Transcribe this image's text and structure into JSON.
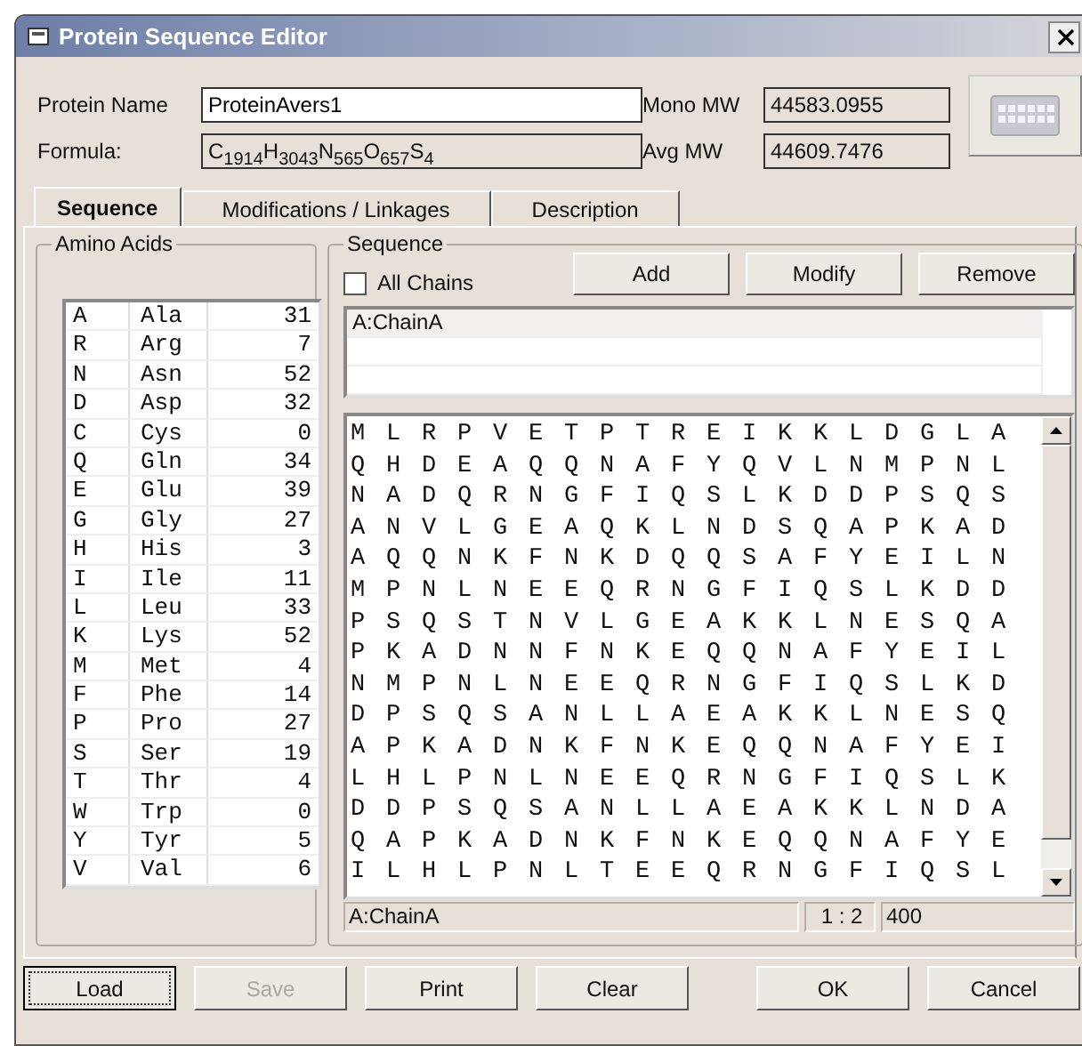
{
  "window": {
    "title": "Protein Sequence Editor"
  },
  "fields": {
    "protein_name_label": "Protein Name",
    "protein_name": "ProteinAvers1",
    "formula_label": "Formula:",
    "formula": "C$_{1914}$H$_{3043}$N$_{565}$O$_{657}$S$_{4}$",
    "mono_mw_label": "Mono MW",
    "mono_mw": "44583.0955",
    "avg_mw_label": "Avg MW",
    "avg_mw": "44609.7476"
  },
  "tabs": [
    {
      "label": "Sequence",
      "selected": true
    },
    {
      "label": "Modifications / Linkages",
      "selected": false
    },
    {
      "label": "Description",
      "selected": false
    }
  ],
  "amino_acids": {
    "title": "Amino Acids",
    "rows": [
      [
        "A",
        "Ala",
        "31"
      ],
      [
        "R",
        "Arg",
        "7"
      ],
      [
        "N",
        "Asn",
        "52"
      ],
      [
        "D",
        "Asp",
        "32"
      ],
      [
        "C",
        "Cys",
        "0"
      ],
      [
        "Q",
        "Gln",
        "34"
      ],
      [
        "E",
        "Glu",
        "39"
      ],
      [
        "G",
        "Gly",
        "27"
      ],
      [
        "H",
        "His",
        "3"
      ],
      [
        "I",
        "Ile",
        "11"
      ],
      [
        "L",
        "Leu",
        "33"
      ],
      [
        "K",
        "Lys",
        "52"
      ],
      [
        "M",
        "Met",
        "4"
      ],
      [
        "F",
        "Phe",
        "14"
      ],
      [
        "P",
        "Pro",
        "27"
      ],
      [
        "S",
        "Ser",
        "19"
      ],
      [
        "T",
        "Thr",
        "4"
      ],
      [
        "W",
        "Trp",
        "0"
      ],
      [
        "Y",
        "Tyr",
        "5"
      ],
      [
        "V",
        "Val",
        "6"
      ]
    ]
  },
  "sequence": {
    "title": "Sequence",
    "all_chains": {
      "label": "All Chains",
      "checked": false
    },
    "buttons": [
      "Add",
      "Modify",
      "Remove"
    ],
    "chains": [
      {
        "label": "A:ChainA",
        "selected": true
      }
    ],
    "rows": [
      "M L R P V E T P T R E I K K L D G L A",
      "Q H D E A Q Q N A F Y Q V L N M P N L",
      "N A D Q R N G F I Q S L K D D P S Q S",
      "A N V L G E A Q K L N D S Q A P K A D",
      "A Q Q N K F N K D Q Q S A F Y E I L N",
      "M P N L N E E Q R N G F I Q S L K D D",
      "P S Q S T N V L G E A K K L N E S Q A",
      "P K A D N N F N K E Q Q N A F Y E I L",
      "N M P N L N E E Q R N G F I Q S L K D",
      "D P S Q S A N L L A E A K K L N E S Q",
      "A P K A D N K F N K E Q Q N A F Y E I",
      "L H L P N L N E E Q R N G F I Q S L K",
      "D D P S Q S A N L L A E A K K L N D A",
      "Q A P K A D N K F N K E Q Q N A F Y E",
      "I L H L P N L T E E Q R N G F I Q S L"
    ],
    "status": [
      "A:ChainA",
      "1 : 2",
      "400"
    ]
  },
  "bottom_buttons": [
    {
      "label": "Load",
      "disabled": false,
      "focused": true
    },
    {
      "label": "Save",
      "disabled": true,
      "focused": false
    },
    {
      "label": "Print",
      "disabled": false,
      "focused": false
    },
    {
      "label": "Clear",
      "disabled": false,
      "focused": false
    },
    {
      "label": "OK",
      "disabled": false,
      "focused": false
    },
    {
      "label": "Cancel",
      "disabled": false,
      "focused": false
    }
  ]
}
